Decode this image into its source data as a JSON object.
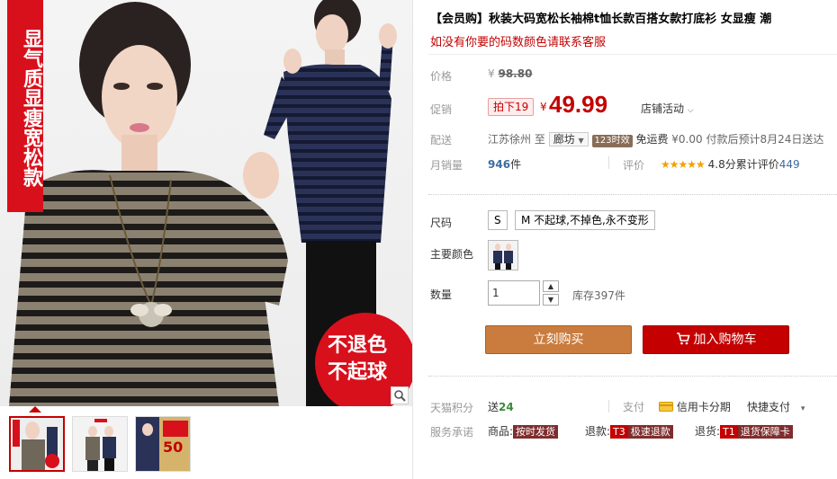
{
  "gallery": {
    "banner_chars": [
      "显",
      "气",
      "质",
      "显",
      "瘦",
      "宽",
      "松",
      "款"
    ],
    "promo_line1": "不退色",
    "promo_line2": "不起球",
    "thumb3_text": "50"
  },
  "product": {
    "title": "【会员购】秋装大码宽松长袖棉t恤长款百搭女款打底衫 女显瘦 潮",
    "subtitle": "如没有你要的码数颜色请联系客服"
  },
  "price": {
    "label": "价格",
    "currency": "¥",
    "original": "98.80",
    "promo_label": "促销",
    "promo_tag": "拍下19",
    "promo_value": "49.99",
    "store_activity": "店铺活动"
  },
  "shipping": {
    "label": "配送",
    "from": "江苏徐州",
    "to_word": "至",
    "destination": "廊坊",
    "badge": "123时效",
    "free": "免运费",
    "fee": "¥0.00",
    "eta": "付款后预计8月24日送达"
  },
  "sales": {
    "label": "月销量",
    "count": "946",
    "unit": "件",
    "rating_label": "评价",
    "stars": "★★★★★",
    "score": "4.8分",
    "reviews_text": "累计评价",
    "reviews_count": "449"
  },
  "sku": {
    "size_label": "尺码",
    "sizes": [
      "S",
      "M 不起球,不掉色,永不变形"
    ],
    "color_label": "主要颜色",
    "qty_label": "数量",
    "qty_value": "1",
    "stock": "库存397件"
  },
  "actions": {
    "buy": "立刻购买",
    "cart": "加入购物车"
  },
  "points": {
    "label": "天猫积分",
    "send_word": "送",
    "amount": "24",
    "pay_label": "支付",
    "credit": "信用卡分期",
    "quick": "快捷支付"
  },
  "service": {
    "label": "服务承诺",
    "goods_label": "商品:",
    "goods_tag": "按时发货",
    "refund_label": "退款:",
    "refund_tag_code": "T3",
    "refund_tag": "极速退款",
    "return_label": "退货:",
    "return_tag_code": "T1",
    "return_tag": "退货保障卡"
  },
  "colors": {
    "accent": "#c40000",
    "buy_button": "#c97c3d",
    "link": "#3d6ca1",
    "star": "#f4a000"
  }
}
